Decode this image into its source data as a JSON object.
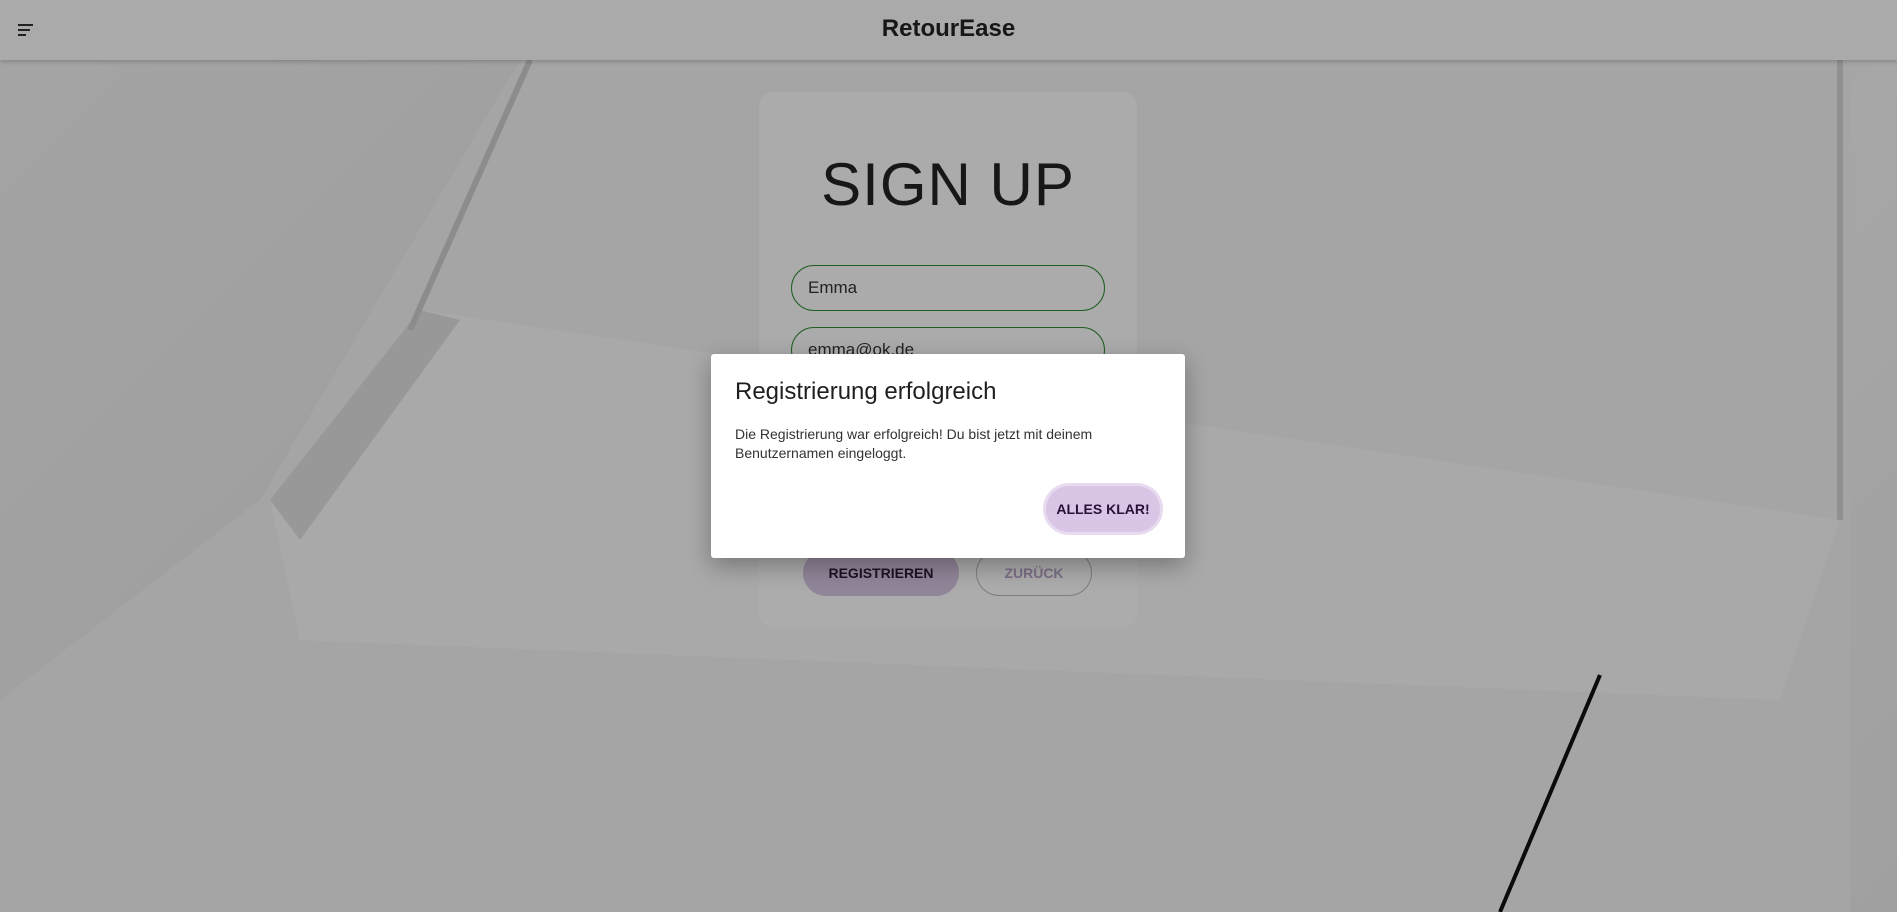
{
  "header": {
    "menu_icon": "menu-icon",
    "title": "RetourEase"
  },
  "signup": {
    "title": "SIGN UP",
    "name_value": "Emma",
    "email_value": "emma@ok.de",
    "register_label": "REGISTRIEREN",
    "back_label": "ZURÜCK",
    "field_border_color": "#2e8b2e"
  },
  "dialog": {
    "title": "Registrierung erfolgreich",
    "message": "Die Registrierung war erfolgreich! Du bist jetzt mit deinem Benutzernamen eingeloggt.",
    "ok_label": "ALLES KLAR!",
    "accent_color": "#d9c6e6"
  }
}
